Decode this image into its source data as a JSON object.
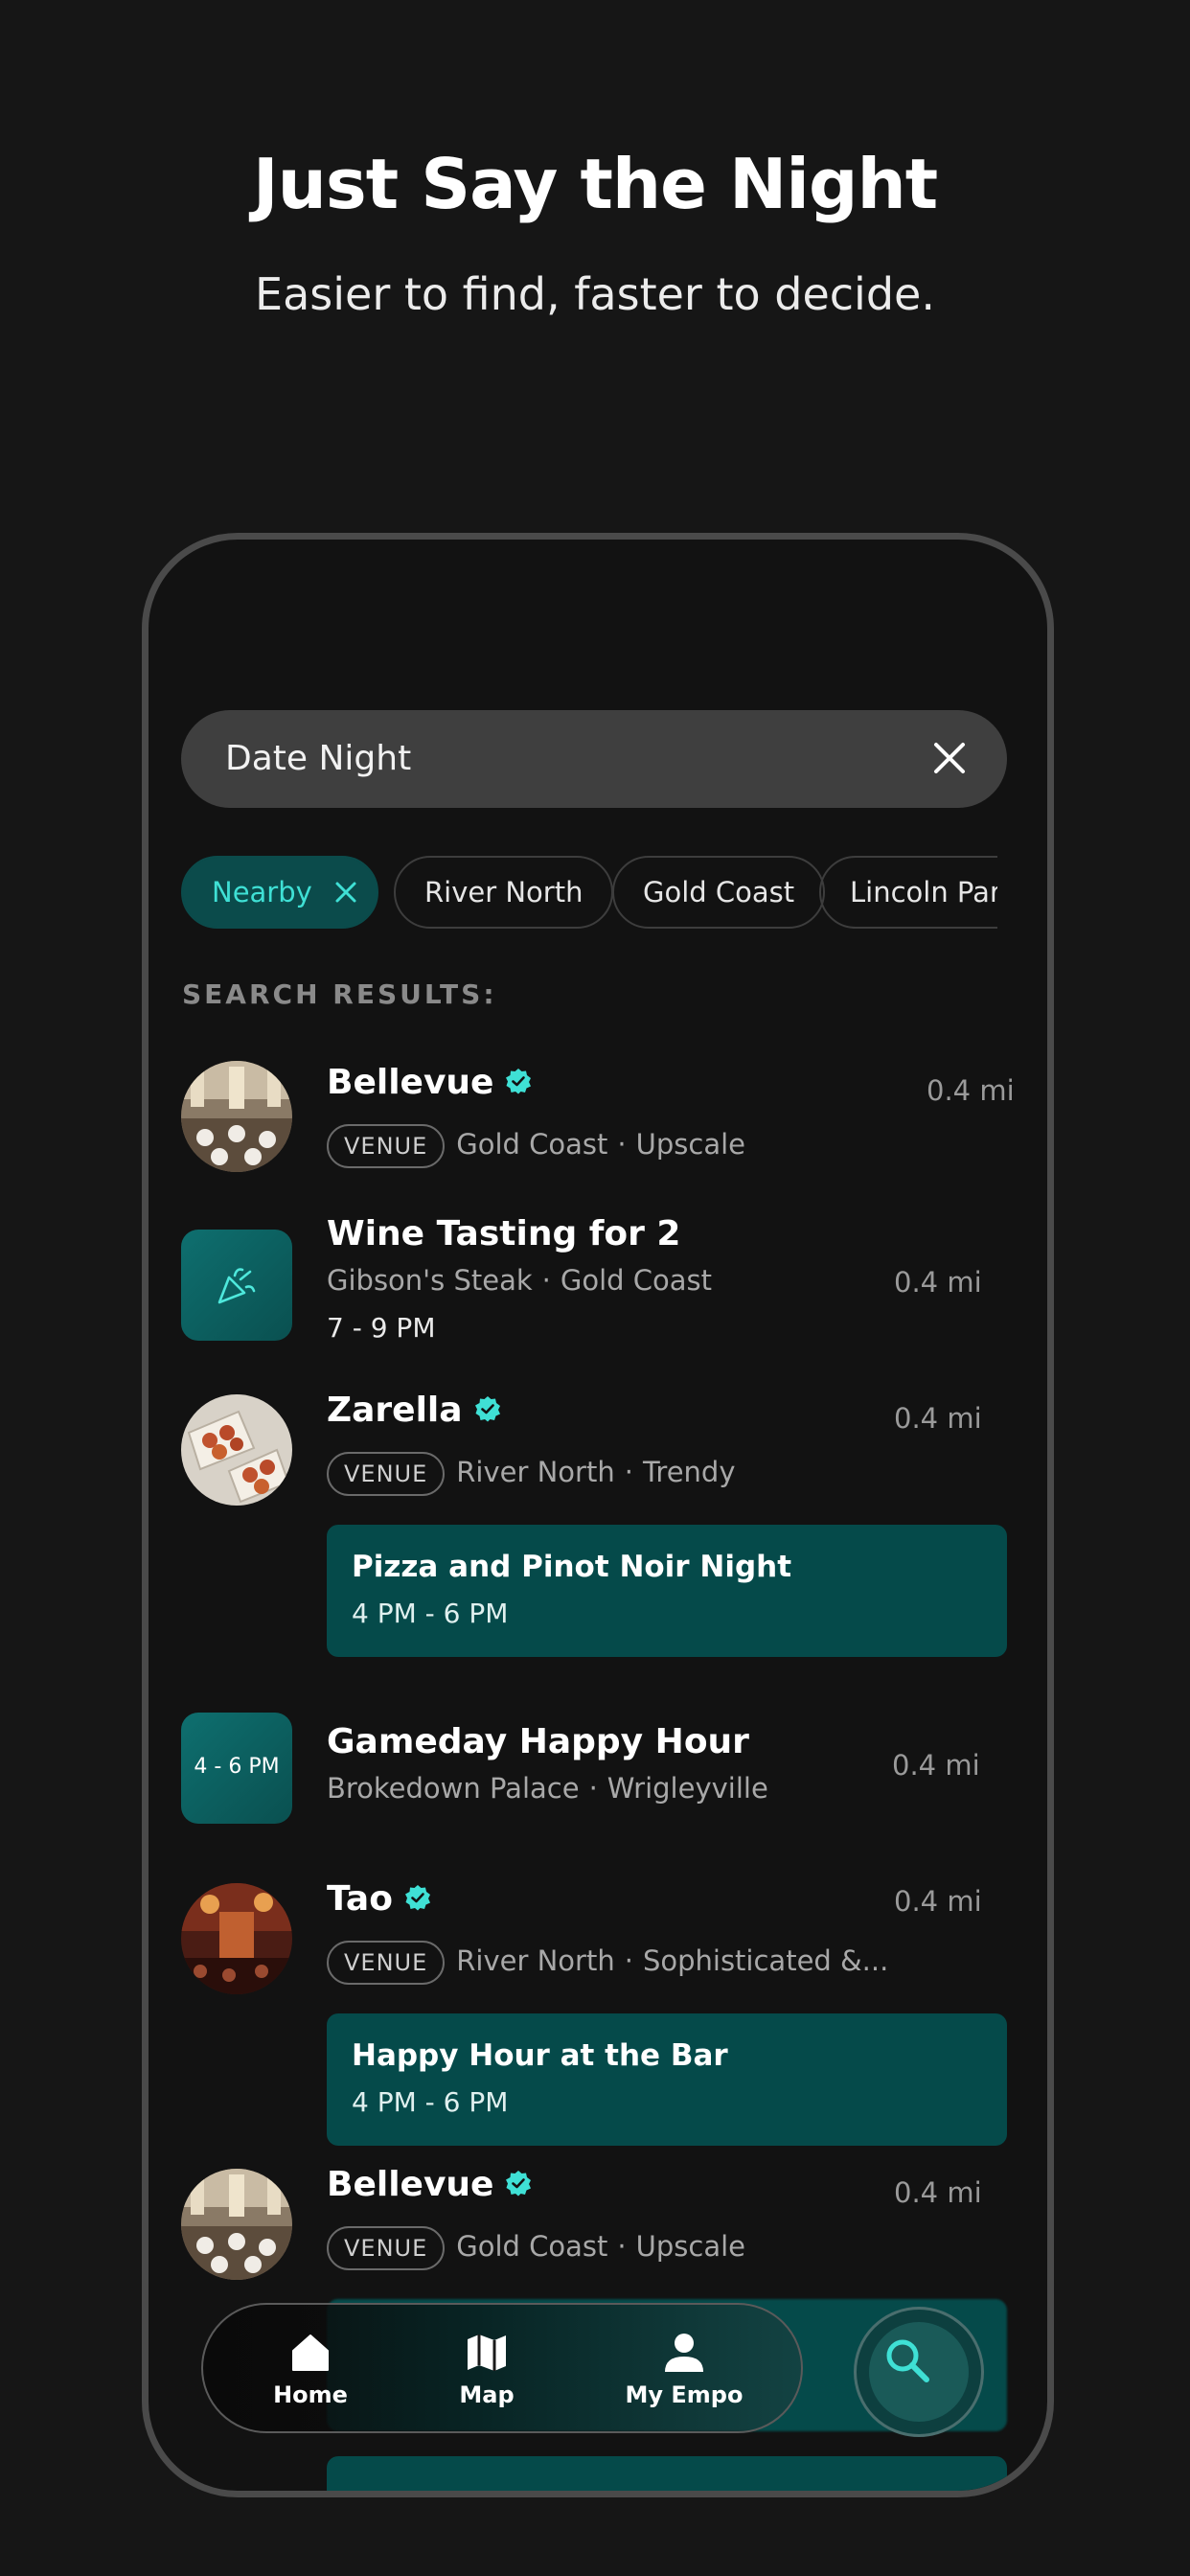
{
  "hero": {
    "title": "Just Say the Night",
    "subtitle": "Easier to find, faster to decide."
  },
  "search": {
    "query": "Date Night",
    "clear_icon": "close-icon"
  },
  "filters": [
    {
      "label": "Nearby",
      "active": true
    },
    {
      "label": "River North",
      "active": false
    },
    {
      "label": "Gold Coast",
      "active": false
    },
    {
      "label": "Lincoln Park",
      "active": false
    }
  ],
  "results_label": "SEARCH RESULTS:",
  "results": [
    {
      "kind": "venue",
      "name": "Bellevue",
      "verified": true,
      "badge": "VENUE",
      "area": "Gold Coast",
      "vibe": "Upscale",
      "distance": "0.4 mi"
    },
    {
      "kind": "event",
      "name": "Wine Tasting for 2",
      "venue": "Gibson's Steak",
      "area": "Gold Coast",
      "time": "7 - 9 PM",
      "distance": "0.4 mi",
      "icon": "party-popper-icon"
    },
    {
      "kind": "venue",
      "name": "Zarella",
      "verified": true,
      "badge": "VENUE",
      "area": "River North",
      "vibe": "Trendy",
      "distance": "0.4 mi",
      "event": {
        "title": "Pizza and Pinot Noir Night",
        "time": "4 PM - 6 PM"
      }
    },
    {
      "kind": "happy-hour",
      "name": "Gameday Happy Hour",
      "venue": "Brokedown Palace",
      "area": "Wrigleyville",
      "thumb_label": "4 - 6 PM",
      "distance": "0.4 mi"
    },
    {
      "kind": "venue",
      "name": "Tao",
      "verified": true,
      "badge": "VENUE",
      "area": "River North",
      "vibe": "Sophisticated &...",
      "distance": "0.4 mi",
      "event": {
        "title": "Happy Hour at the Bar",
        "time": "4 PM - 6 PM"
      }
    },
    {
      "kind": "venue",
      "name": "Bellevue",
      "verified": true,
      "badge": "VENUE",
      "area": "Gold Coast",
      "vibe": "Upscale",
      "distance": "0.4 mi"
    }
  ],
  "tabbar": {
    "items": [
      {
        "label": "Home",
        "icon": "home-icon"
      },
      {
        "label": "Map",
        "icon": "map-icon"
      },
      {
        "label": "My Empo",
        "icon": "profile-icon"
      }
    ],
    "search_icon": "search-icon"
  },
  "colors": {
    "accent": "#3fe0d5",
    "card": "#054a4a",
    "background": "#121212"
  }
}
